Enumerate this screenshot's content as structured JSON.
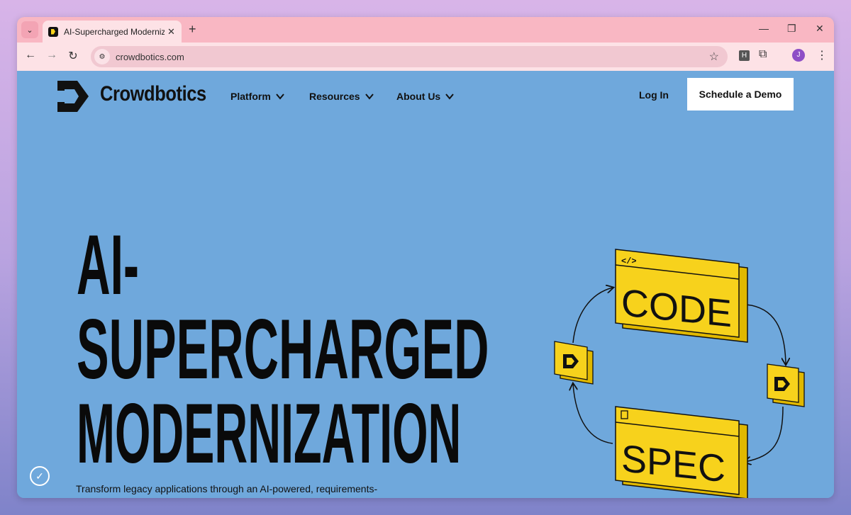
{
  "browser": {
    "tab_title": "AI-Supercharged Modernization",
    "url": "crowdbotics.com",
    "profile_initial": "J",
    "extension_label": "H"
  },
  "nav": {
    "brand": "Crowdbotics",
    "items": [
      "Platform",
      "Resources",
      "About Us"
    ],
    "login": "Log In",
    "cta": "Schedule a Demo"
  },
  "hero": {
    "line1": "AI-",
    "line2": "SUPERCHARGED",
    "line3": "MODERNIZATION",
    "subtitle": "Transform legacy applications through an AI-powered, requirements-"
  },
  "diagram": {
    "code_label": "CODE",
    "spec_label": "SPEC",
    "code_tag": "</>"
  },
  "colors": {
    "page_bg": "#6fa8dc",
    "accent_yellow": "#f7d21c",
    "tab_bar": "#f9b7c3"
  }
}
